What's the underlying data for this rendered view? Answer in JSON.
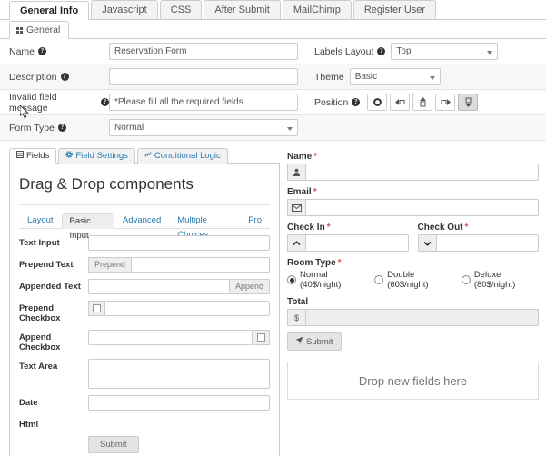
{
  "top_tabs": [
    {
      "label": "General Info",
      "active": true
    },
    {
      "label": "Javascript",
      "active": false
    },
    {
      "label": "CSS",
      "active": false
    },
    {
      "label": "After Submit",
      "active": false
    },
    {
      "label": "MailChimp",
      "active": false
    },
    {
      "label": "Register User",
      "active": false
    }
  ],
  "sub_tab": {
    "label": "General",
    "icon": "grid-icon"
  },
  "settings": {
    "name": {
      "label": "Name",
      "value": "Reservation Form",
      "help": "?"
    },
    "labels_layout": {
      "label": "Labels Layout",
      "value": "Top",
      "help": "?"
    },
    "description": {
      "label": "Description",
      "value": "",
      "help": "?"
    },
    "theme": {
      "label": "Theme",
      "value": "Basic"
    },
    "invalid_message": {
      "label": "Invalid field message",
      "value": "*Please fill all the required fields",
      "help": "?"
    },
    "position": {
      "label": "Position",
      "help": "?",
      "buttons": [
        {
          "name": "position-none",
          "active": false
        },
        {
          "name": "position-left",
          "active": false
        },
        {
          "name": "position-top",
          "active": false
        },
        {
          "name": "position-right",
          "active": false
        },
        {
          "name": "position-bottom",
          "active": true
        }
      ]
    },
    "form_type": {
      "label": "Form Type",
      "value": "Normal",
      "help": "?"
    }
  },
  "builder": {
    "panel_tabs": [
      {
        "label": "Fields",
        "icon": "fields-icon",
        "active": true
      },
      {
        "label": "Field Settings",
        "icon": "gear-icon",
        "active": false
      },
      {
        "label": "Conditional Logic",
        "icon": "link-icon",
        "active": false
      }
    ],
    "title": "Drag & Drop components",
    "inner_tabs": [
      {
        "label": "Layout",
        "active": false
      },
      {
        "label": "Basic Input",
        "active": true
      },
      {
        "label": "Advanced",
        "active": false
      },
      {
        "label": "Multiple Choices",
        "active": false
      },
      {
        "label": "Pro",
        "active": false
      }
    ],
    "components": [
      {
        "label": "Text Input",
        "type": "input"
      },
      {
        "label": "Prepend Text",
        "type": "prepend-text",
        "addon": "Prepend"
      },
      {
        "label": "Appended Text",
        "type": "append-text",
        "addon": "Append"
      },
      {
        "label": "Prepend Checkbox",
        "type": "prepend-checkbox"
      },
      {
        "label": "Append Checkbox",
        "type": "append-checkbox"
      },
      {
        "label": "Text Area",
        "type": "textarea"
      },
      {
        "label": "Date",
        "type": "input"
      },
      {
        "label": "Html",
        "type": "html"
      }
    ],
    "submit_label": "Submit"
  },
  "preview": {
    "fields": [
      {
        "label": "Name",
        "required": true,
        "icon": "user-icon",
        "value": ""
      },
      {
        "label": "Email",
        "required": true,
        "icon": "envelope-icon",
        "value": ""
      }
    ],
    "check_in": {
      "label": "Check In",
      "required": true,
      "icon": "chevron-up-icon",
      "value": ""
    },
    "check_out": {
      "label": "Check Out",
      "required": true,
      "icon": "chevron-down-icon",
      "value": ""
    },
    "room_type": {
      "label": "Room Type",
      "required": true,
      "options": [
        {
          "label": "Normal (40$/night)",
          "selected": true
        },
        {
          "label": "Double (60$/night)",
          "selected": false
        },
        {
          "label": "Deluxe (80$/night)",
          "selected": false
        }
      ]
    },
    "total": {
      "label": "Total",
      "required": false,
      "icon": "dollar-icon",
      "prefix": "$",
      "value": ""
    },
    "submit": {
      "label": "Submit",
      "icon": "paper-plane-icon"
    },
    "dropzone": "Drop new fields here"
  },
  "colors": {
    "link": "#2a7ab0",
    "required": "#d9534f",
    "border": "#cccccc",
    "panel_bg": "#f7f7f7"
  }
}
